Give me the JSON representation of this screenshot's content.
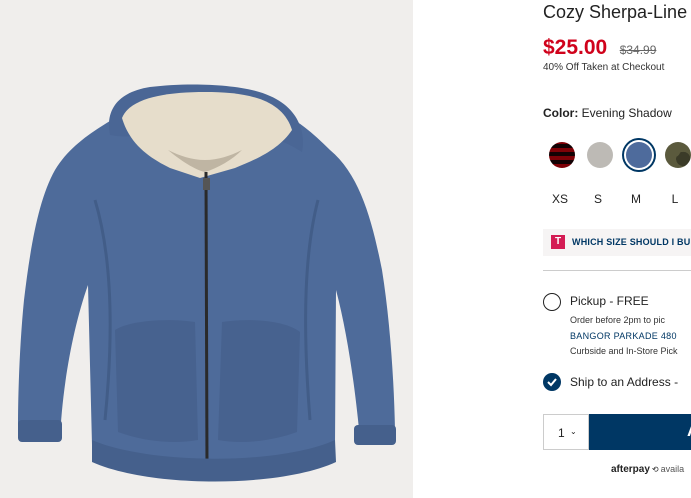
{
  "product": {
    "title": "Cozy Sherpa-Line",
    "price": "$25.00",
    "regular_price": "$34.99",
    "discount_note": "40% Off Taken at Checkout",
    "image_alt": "Blue sherpa-lined zip hoodie"
  },
  "color": {
    "label": "Color:",
    "selected": "Evening Shadow",
    "swatches": [
      {
        "name": "red-plaid",
        "colors": [
          "#b3122a",
          "#1b1b1b"
        ]
      },
      {
        "name": "heather-gray",
        "colors": [
          "#bdbab5"
        ]
      },
      {
        "name": "evening-shadow",
        "colors": [
          "#4e6b9c"
        ]
      },
      {
        "name": "camo",
        "colors": [
          "#5b5a3d",
          "#3b3b28"
        ]
      }
    ]
  },
  "sizes": [
    "XS",
    "S",
    "M",
    "L"
  ],
  "size_guide": {
    "logo": "T",
    "text": "WHICH SIZE SHOULD I BU"
  },
  "fulfillment": {
    "pickup_label": "Pickup - FREE",
    "pickup_note": "Order before 2pm to pic",
    "store_name": "BANGOR PARKADE 480",
    "curbside_note": "Curbside and In-Store Pick",
    "ship_label": "Ship to an Address -"
  },
  "cart": {
    "quantity": "1",
    "quantity_chevron": "⌄",
    "add_button_label": "A"
  },
  "afterpay": {
    "logo": "afterpay",
    "icon": "⟲",
    "text": "availa"
  },
  "colors": {
    "brand_navy": "#003764",
    "sale_red": "#d0021b",
    "size_guide_pink": "#d41c54"
  }
}
